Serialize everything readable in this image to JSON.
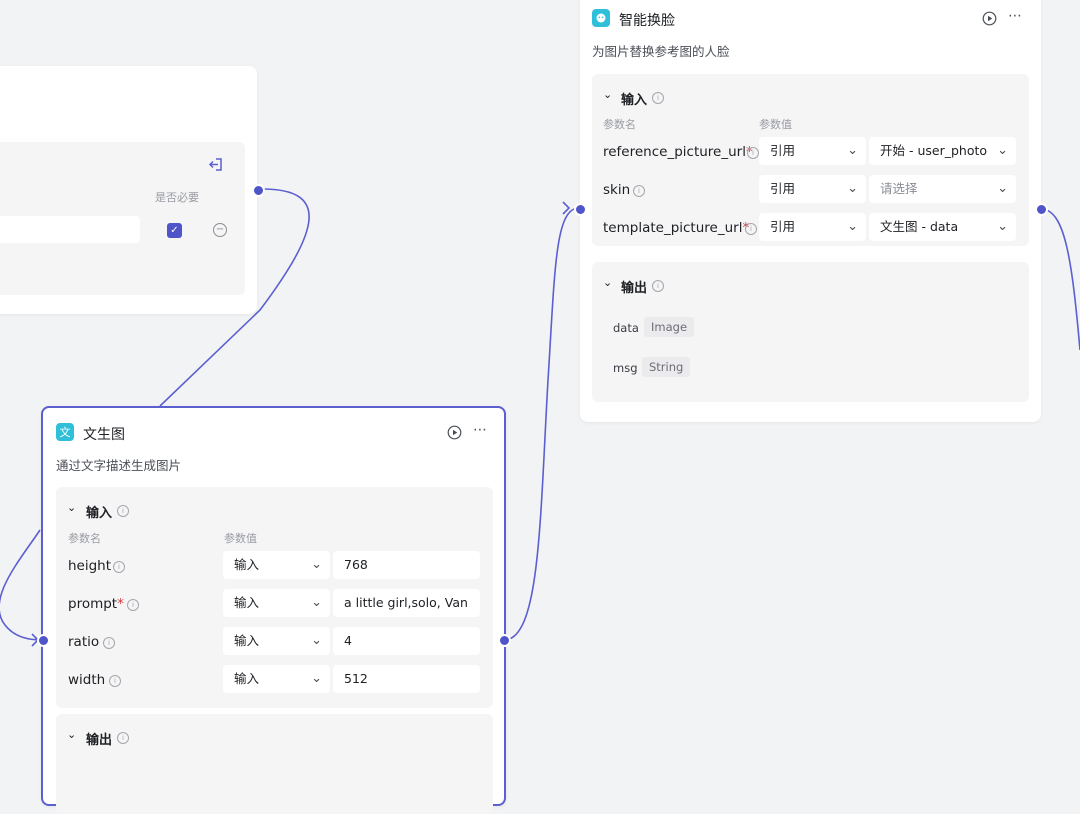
{
  "colors": {
    "accent": "#4f55c9",
    "node_icon_cyan": "#2fbfd8"
  },
  "start_node": {
    "required_col": "是否必要",
    "exit_icon": "exit-icon"
  },
  "text2img_node": {
    "icon_text": "文",
    "title": "文生图",
    "description": "通过文字描述生成图片",
    "input_section": "输入",
    "output_section": "输出",
    "col_name": "参数名",
    "col_value": "参数值",
    "params": [
      {
        "name": "height",
        "required": "",
        "mode": "输入",
        "value": "768"
      },
      {
        "name": "prompt",
        "required": "*",
        "mode": "输入",
        "value": "a little girl,solo, Van G"
      },
      {
        "name": "ratio",
        "required": "",
        "mode": "输入",
        "value": "4"
      },
      {
        "name": "width",
        "required": "",
        "mode": "输入",
        "value": "512"
      }
    ]
  },
  "faceswap_node": {
    "title": "智能换脸",
    "description": "为图片替换参考图的人脸",
    "input_section": "输入",
    "output_section": "输出",
    "col_name": "参数名",
    "col_value": "参数值",
    "params": [
      {
        "name": "reference_picture_url",
        "required": "*",
        "mode": "引用",
        "value": "开始 - user_photo"
      },
      {
        "name": "skin",
        "required": "",
        "mode": "引用",
        "value": "请选择"
      },
      {
        "name": "template_picture_url",
        "required": "*",
        "mode": "引用",
        "value": "文生图 - data"
      }
    ],
    "outputs": [
      {
        "name": "data",
        "type": "Image"
      },
      {
        "name": "msg",
        "type": "String"
      }
    ]
  }
}
